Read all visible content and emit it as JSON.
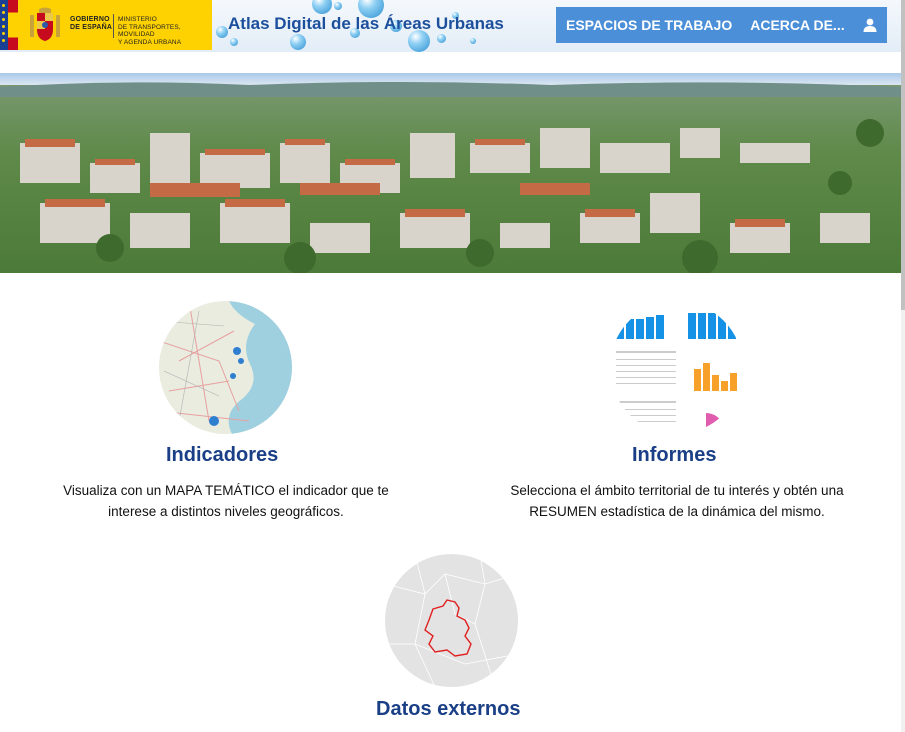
{
  "header": {
    "gov_line1": "GOBIERNO",
    "gov_line2": "DE ESPAÑA",
    "ministry_line1": "MINISTERIO",
    "ministry_line2": "DE TRANSPORTES, MOVILIDAD",
    "ministry_line3": "Y AGENDA URBANA",
    "app_title": "Atlas Digital de las Áreas Urbanas"
  },
  "nav": {
    "workspaces_label": "ESPACIOS DE TRABAJO",
    "about_label": "ACERCA DE..."
  },
  "cards": {
    "indicators": {
      "title": "Indicadores",
      "desc_line1": "Visualiza con un MAPA TEMÁTICO el indicador que te",
      "desc_line2": "interese a distintos niveles geográficos."
    },
    "reports": {
      "title": "Informes",
      "desc_line1": "Selecciona el ámbito territorial de tu interés y obtén una",
      "desc_line2": "RESUMEN estadística de la dinámica del mismo."
    },
    "external": {
      "title": "Datos externos"
    }
  },
  "colors": {
    "accent": "#4a8fd7",
    "title_blue": "#1a3f86",
    "gov_yellow": "#fed200"
  },
  "icons": {
    "user": "user-icon",
    "shield": "coat-of-arms-icon"
  }
}
